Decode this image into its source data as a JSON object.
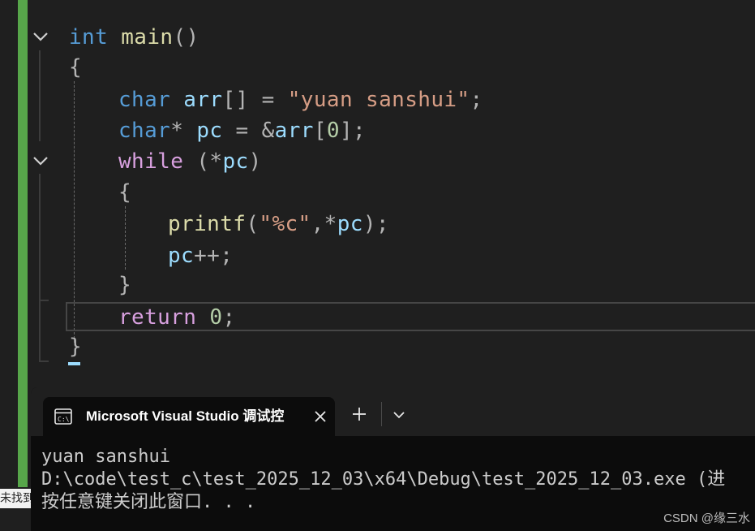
{
  "editor": {
    "code": [
      {
        "tokens": [
          {
            "t": "int",
            "c": "kw"
          },
          {
            "t": " "
          },
          {
            "t": "main",
            "c": "fn"
          },
          {
            "t": "()",
            "c": "op"
          }
        ]
      },
      {
        "tokens": [
          {
            "t": "{",
            "c": "op"
          }
        ]
      },
      {
        "tokens": [
          {
            "t": "char",
            "c": "kw"
          },
          {
            "t": " "
          },
          {
            "t": "arr",
            "c": "var"
          },
          {
            "t": "[] = ",
            "c": "op"
          },
          {
            "t": "\"yuan sanshui\"",
            "c": "str"
          },
          {
            "t": ";",
            "c": "op"
          }
        ]
      },
      {
        "tokens": [
          {
            "t": "char",
            "c": "kw"
          },
          {
            "t": "* ",
            "c": "op"
          },
          {
            "t": "pc",
            "c": "var"
          },
          {
            "t": " = &",
            "c": "op"
          },
          {
            "t": "arr",
            "c": "var"
          },
          {
            "t": "[",
            "c": "op"
          },
          {
            "t": "0",
            "c": "num"
          },
          {
            "t": "];",
            "c": "op"
          }
        ]
      },
      {
        "tokens": [
          {
            "t": "while",
            "c": "ctl"
          },
          {
            "t": " (*",
            "c": "op"
          },
          {
            "t": "pc",
            "c": "var"
          },
          {
            "t": ")",
            "c": "op"
          }
        ]
      },
      {
        "tokens": [
          {
            "t": "{",
            "c": "op"
          }
        ]
      },
      {
        "tokens": [
          {
            "t": "printf",
            "c": "fn"
          },
          {
            "t": "(",
            "c": "op"
          },
          {
            "t": "\"%c\"",
            "c": "str"
          },
          {
            "t": ",*",
            "c": "op"
          },
          {
            "t": "pc",
            "c": "var"
          },
          {
            "t": ");",
            "c": "op"
          }
        ]
      },
      {
        "tokens": [
          {
            "t": "pc",
            "c": "var"
          },
          {
            "t": "++;",
            "c": "op"
          }
        ]
      },
      {
        "tokens": [
          {
            "t": "}",
            "c": "op"
          }
        ]
      },
      {
        "tokens": [
          {
            "t": "return",
            "c": "ctl"
          },
          {
            "t": " "
          },
          {
            "t": "0",
            "c": "num"
          },
          {
            "t": ";",
            "c": "op"
          }
        ]
      },
      {
        "tokens": [
          {
            "t": "}",
            "c": "op"
          }
        ]
      }
    ]
  },
  "console_window": {
    "tab_title": "Microsoft Visual Studio 调试控",
    "icons": {
      "tab": "terminal-icon",
      "close": "close-icon",
      "new_tab": "plus-icon",
      "menu": "chevron-down-icon"
    },
    "output": [
      "yuan sanshui",
      "D:\\code\\test_c\\test_2025_12_03\\x64\\Debug\\test_2025_12_03.exe (进",
      "按任意键关闭此窗口. . ."
    ]
  },
  "side_label": "未找到",
  "watermark": "CSDN @缘三水",
  "colors": {
    "background": "#1f1f1f",
    "change_bar": "#57a64a",
    "keyword": "#569cd6",
    "function": "#dcdcaa",
    "string": "#d69d85",
    "variable": "#9cdcfe",
    "control": "#d8a0df",
    "number": "#b5cea8"
  }
}
